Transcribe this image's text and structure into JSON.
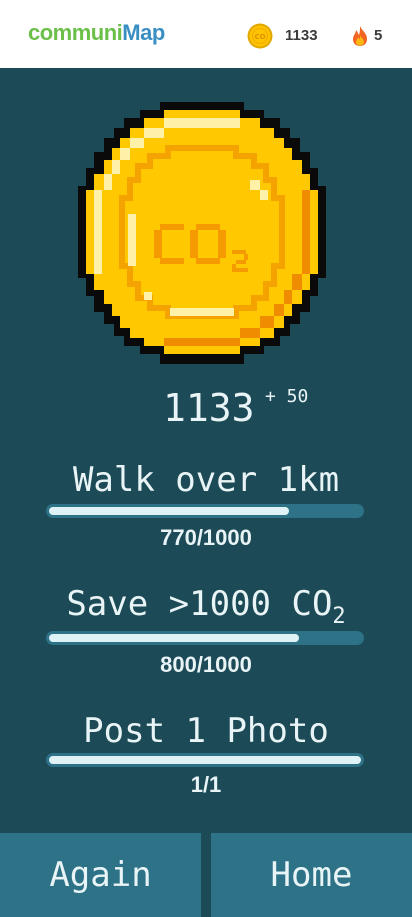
{
  "header": {
    "logo_part1": "communi",
    "logo_part2": "Map",
    "coin_count": "1133",
    "streak_count": "5",
    "brand_green": "#6cc04a",
    "brand_blue": "#3a8fc2"
  },
  "reward": {
    "total": "1133",
    "bonus": "+ 50",
    "coin_label": "CO",
    "coin_sub": "2"
  },
  "challenges": [
    {
      "title": "Walk over 1km",
      "sub": "",
      "progress_text": "770/1000",
      "progress": 0.77
    },
    {
      "title": "Save >1000 CO",
      "sub": "2",
      "progress_text": "800/1000",
      "progress": 0.8
    },
    {
      "title": "Post 1 Photo",
      "sub": "",
      "progress_text": "1/1",
      "progress": 1.0
    }
  ],
  "actions": {
    "again_label": "Again",
    "home_label": "Home"
  },
  "colors": {
    "background": "#1d4a57",
    "accent": "#2d7287",
    "coin_gold": "#ffc800"
  }
}
